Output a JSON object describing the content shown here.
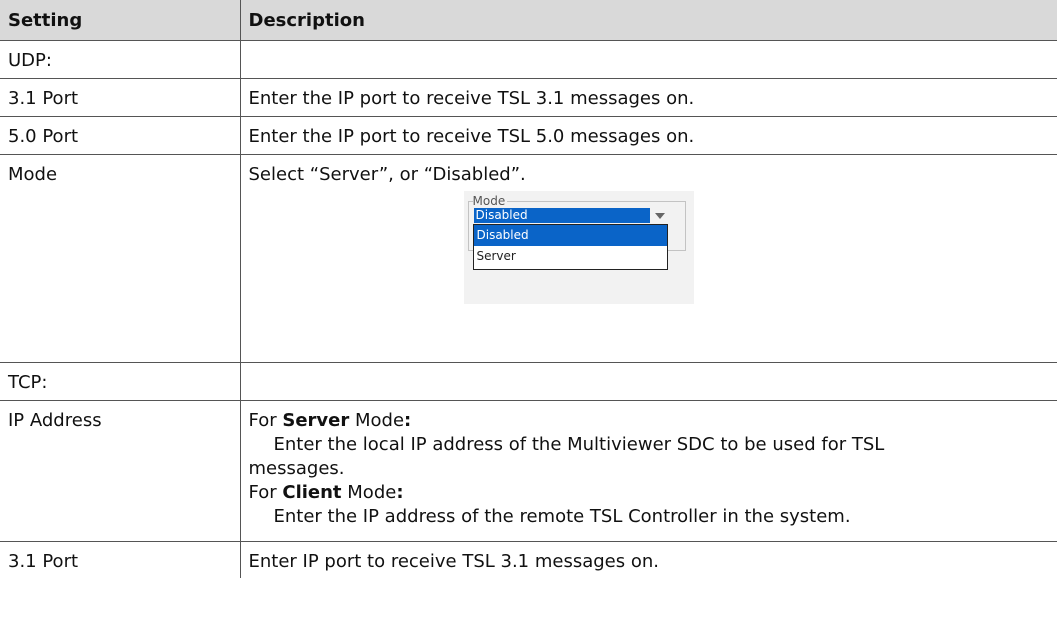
{
  "table": {
    "headers": [
      "Setting",
      "Description"
    ],
    "rows": {
      "udp": {
        "setting": "UDP:",
        "description": ""
      },
      "port31": {
        "setting": "3.1 Port",
        "description": "Enter the IP port to receive TSL 3.1 messages on."
      },
      "port50": {
        "setting": "5.0 Port",
        "description": "Enter the IP port to receive TSL 5.0 messages on."
      },
      "mode": {
        "setting": "Mode",
        "description": "Select “Server”, or “Disabled”."
      },
      "tcp": {
        "setting": "TCP:",
        "description": ""
      },
      "ip": {
        "setting": "IP Address",
        "server_prefix": "For",
        "server_word": "Server",
        "server_suffix": "Mode",
        "server_colon": ":",
        "server_text": "Enter the local IP address of the Multiviewer SDC to be used for TSL",
        "server_text_cont": "messages.",
        "client_prefix": "For",
        "client_word": "Client",
        "client_suffix": "Mode",
        "client_colon": ":",
        "client_text": "Enter the IP address of the remote TSL Controller in the system."
      },
      "port31b": {
        "setting": "3.1 Port",
        "description": "Enter IP port to receive TSL 3.1 messages on."
      }
    }
  },
  "mode_dropdown": {
    "legend": "Mode",
    "selected": "Disabled",
    "options": [
      "Disabled",
      "Server"
    ],
    "accent_color": "#0a64c8"
  }
}
